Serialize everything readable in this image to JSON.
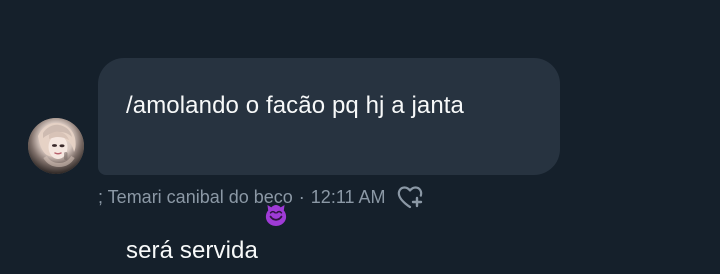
{
  "message": {
    "text_before_emoji": "/amolando o facão pq hj a janta\nserá servida",
    "emoji_name": "smiling-face-with-horns-emoji",
    "sender": "; Temari canibal do beco",
    "separator": "·",
    "time": "12:11 AM"
  },
  "colors": {
    "background": "#15202b",
    "bubble": "#273340",
    "text": "#f7f9f9",
    "meta": "#8b98a5",
    "emoji": "#9f3bd6"
  },
  "icons": {
    "avatar": "avatar",
    "reaction": "heart-plus-icon"
  }
}
